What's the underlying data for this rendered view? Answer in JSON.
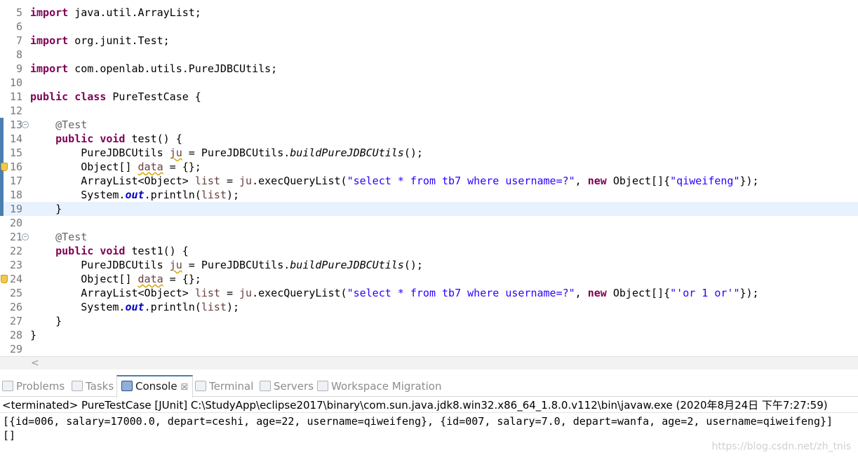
{
  "editor": {
    "lines": [
      {
        "n": "5"
      },
      {
        "n": "6"
      },
      {
        "n": "7"
      },
      {
        "n": "8"
      },
      {
        "n": "9"
      },
      {
        "n": "10"
      },
      {
        "n": "11"
      },
      {
        "n": "12"
      },
      {
        "n": "13"
      },
      {
        "n": "14"
      },
      {
        "n": "15"
      },
      {
        "n": "16"
      },
      {
        "n": "17"
      },
      {
        "n": "18"
      },
      {
        "n": "19"
      },
      {
        "n": "20"
      },
      {
        "n": "21"
      },
      {
        "n": "22"
      },
      {
        "n": "23"
      },
      {
        "n": "24"
      },
      {
        "n": "25"
      },
      {
        "n": "26"
      },
      {
        "n": "27"
      },
      {
        "n": "28"
      },
      {
        "n": "29"
      }
    ],
    "code": {
      "l5": {
        "kw": "import",
        "rest": " java.util.ArrayList;"
      },
      "l7": {
        "kw": "import",
        "rest": " org.junit.Test;"
      },
      "l9": {
        "kw": "import",
        "rest": " com.openlab.utils.PureJDBCUtils;"
      },
      "l11": {
        "kw1": "public",
        "kw2": "class",
        "rest": " PureTestCase {"
      },
      "l13": {
        "ann": "@Test"
      },
      "l14": {
        "kw1": "public",
        "kw2": "void",
        "rest": " test() {"
      },
      "l15": {
        "a": "PureJDBCUtils ",
        "v": "ju",
        "b": " = PureJDBCUtils.",
        "m": "buildPureJDBCUtils",
        "c": "();"
      },
      "l16": {
        "a": "Object[] ",
        "v": "data",
        "b": " = {};"
      },
      "l17": {
        "a": "ArrayList<Object> ",
        "v": "list",
        "b": " = ",
        "v2": "ju",
        "c": ".execQueryList(",
        "s1": "\"select * from tb7 where username=?\"",
        "d": ", ",
        "kw": "new",
        "e": " Object[]{",
        "s2": "\"qiweifeng\"",
        "f": "});"
      },
      "l18": {
        "a": "System.",
        "fld": "out",
        "b": ".println(",
        "v": "list",
        "c": ");"
      },
      "l19": {
        "a": "}"
      },
      "l21": {
        "ann": "@Test"
      },
      "l22": {
        "kw1": "public",
        "kw2": "void",
        "rest": " test1() {"
      },
      "l23": {
        "a": "PureJDBCUtils ",
        "v": "ju",
        "b": " = PureJDBCUtils.",
        "m": "buildPureJDBCUtils",
        "c": "();"
      },
      "l24": {
        "a": "Object[] ",
        "v": "data",
        "b": " = {};"
      },
      "l25": {
        "a": "ArrayList<Object> ",
        "v": "list",
        "b": " = ",
        "v2": "ju",
        "c": ".execQueryList(",
        "s1": "\"select * from tb7 where username=?\"",
        "d": ", ",
        "kw": "new",
        "e": " Object[]{",
        "s2": "\"'or 1 or'\"",
        "f": "});"
      },
      "l26": {
        "a": "System.",
        "fld": "out",
        "b": ".println(",
        "v": "list",
        "c": ");"
      },
      "l27": {
        "a": "}"
      },
      "l28": {
        "a": "}"
      }
    }
  },
  "scroll": {
    "left_arrow": "<"
  },
  "tabs": {
    "problems": "Problems",
    "tasks": "Tasks",
    "console": "Console",
    "console_close": "☒",
    "terminal": "Terminal",
    "servers": "Servers",
    "workspace_migration": "Workspace Migration"
  },
  "console": {
    "status": "<terminated> PureTestCase [JUnit] C:\\StudyApp\\eclipse2017\\binary\\com.sun.java.jdk8.win32.x86_64_1.8.0.v112\\bin\\javaw.exe (2020年8月24日 下午7:27:59)",
    "output": [
      "[{id=006, salary=17000.0, depart=ceshi, age=22, username=qiweifeng}, {id=007, salary=7.0, depart=wanfa, age=2, username=qiweifeng}]",
      "[]"
    ]
  },
  "watermark": "https://blog.csdn.net/zh_tnis"
}
